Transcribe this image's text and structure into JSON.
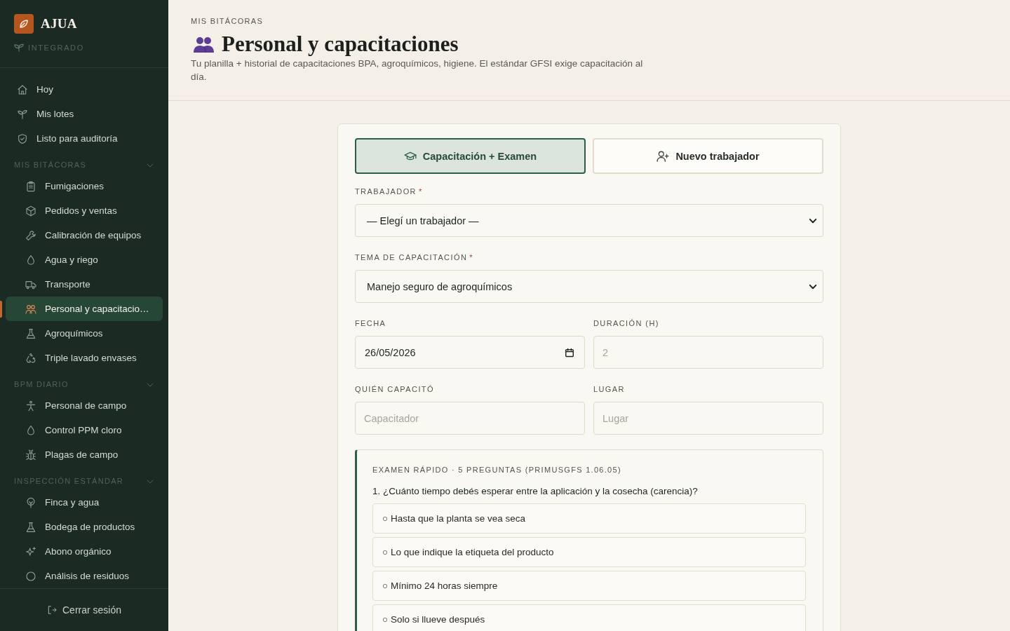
{
  "sidebar": {
    "brand": {
      "name": "AJUA",
      "tagline": "INTEGRADO"
    },
    "main_nav": [
      {
        "label": "Hoy",
        "selected": false
      },
      {
        "label": "Mis lotes",
        "selected": false
      },
      {
        "label": "Listo para auditoría",
        "selected": false
      }
    ],
    "sections": [
      {
        "title": "MIS BITÁCORAS",
        "expanded": true,
        "items": [
          {
            "label": "Fumigaciones",
            "selected": false
          },
          {
            "label": "Pedidos y ventas",
            "selected": false
          },
          {
            "label": "Calibración de equipos",
            "selected": false
          },
          {
            "label": "Agua y riego",
            "selected": false
          },
          {
            "label": "Transporte",
            "selected": false
          },
          {
            "label": "Personal y capacitacio…",
            "selected": true
          },
          {
            "label": "Agroquímicos",
            "selected": false
          },
          {
            "label": "Triple lavado envases",
            "selected": false
          }
        ]
      },
      {
        "title": "BPM DIARIO",
        "expanded": true,
        "items": [
          {
            "label": "Personal de campo",
            "selected": false
          },
          {
            "label": "Control PPM cloro",
            "selected": false
          },
          {
            "label": "Plagas de campo",
            "selected": false
          }
        ]
      },
      {
        "title": "INSPECCIÓN ESTÁNDAR",
        "expanded": true,
        "items": [
          {
            "label": "Finca y agua",
            "selected": false
          },
          {
            "label": "Bodega de productos",
            "selected": false
          },
          {
            "label": "Abono orgánico",
            "selected": false
          },
          {
            "label": "Análisis de residuos",
            "selected": false
          }
        ]
      }
    ],
    "logout": "Cerrar sesión"
  },
  "header": {
    "breadcrumb": "MIS BITÁCORAS",
    "title": "Personal y capacitaciones",
    "description": "Tu planilla + historial de capacitaciones BPA, agroquímicos, higiene. El estándar GFSI exige capacitación al día."
  },
  "form": {
    "tabs": [
      {
        "label": "Capacitación + Examen",
        "selected": true
      },
      {
        "label": "Nuevo trabajador",
        "selected": false
      }
    ],
    "rows": [
      {
        "fields": [
          {
            "kind": "select",
            "label": "TRABAJADOR",
            "required_mark": "*",
            "value": "— Elegí un trabajador —"
          }
        ]
      },
      {
        "fields": [
          {
            "kind": "select",
            "label": "TEMA DE CAPACITACIÓN",
            "required_mark": "*",
            "value": "Manejo seguro de agroquímicos"
          }
        ]
      },
      {
        "fields": [
          {
            "kind": "date",
            "label": "FECHA",
            "value": "26/05/2026"
          },
          {
            "kind": "number",
            "label": "DURACIÓN (H)",
            "placeholder": "2"
          }
        ]
      },
      {
        "fields": [
          {
            "kind": "text",
            "label": "QUIÉN CAPACITÓ",
            "placeholder": "Capacitador"
          },
          {
            "kind": "text",
            "label": "LUGAR",
            "placeholder": "Lugar"
          }
        ]
      }
    ],
    "exam": {
      "title": "EXAMEN RÁPIDO · 5 PREGUNTAS (PRIMUSGFS 1.06.05)",
      "questions": [
        {
          "text": "1. ¿Cuánto tiempo debés esperar entre la aplicación y la cosecha (carencia)?",
          "options": [
            {
              "label": "○ Hasta que la planta se vea seca",
              "selected": false
            },
            {
              "label": "○ Lo que indique la etiqueta del producto",
              "selected": false
            },
            {
              "label": "○ Mínimo 24 horas siempre",
              "selected": false
            },
            {
              "label": "○ Solo si llueve después",
              "selected": false
            }
          ]
        }
      ]
    }
  }
}
